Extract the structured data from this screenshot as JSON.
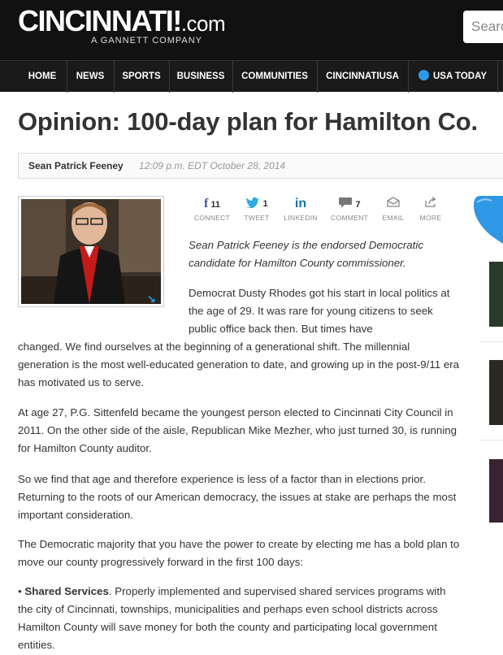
{
  "header": {
    "logo_main": "CINCINNATI",
    "logo_bang": "!",
    "logo_com": ".com",
    "logo_sub": "A GANNETT COMPANY",
    "search_placeholder": "Searc"
  },
  "nav": {
    "items": [
      {
        "label": "HOME"
      },
      {
        "label": "NEWS"
      },
      {
        "label": "SPORTS"
      },
      {
        "label": "BUSINESS"
      },
      {
        "label": "COMMUNITIES"
      },
      {
        "label": "CINCINNATIUSA"
      },
      {
        "label": "USA TODAY"
      }
    ]
  },
  "article": {
    "headline": "Opinion: 100-day plan for Hamilton Co.",
    "author": "Sean Patrick Feeney",
    "timestamp": "12:09 p.m. EDT October 28, 2014",
    "intro": "Sean Patrick Feeney is the endorsed Democratic candidate for Hamilton County commissioner.",
    "p1_part1": "Democrat Dusty Rhodes got his start in local politics at the age of 29. It was rare for young citizens to seek public office back then. But times have",
    "p1_part2": "changed. We find ourselves at the beginning of a generational shift. The millennial generation is the most well-educated generation to date, and growing up in the post-9/11 era has motivated us to serve.",
    "p2": "At age 27, P.G. Sittenfeld became the youngest person elected to Cincinnati City Council in 2011. On the other side of the aisle, Republican Mike Mezher, who just turned 30, is running for Hamilton County auditor.",
    "p3": "So we find that age and therefore experience is less of a factor than in elections prior. Returning to the roots of our American democracy, the issues at stake are perhaps the most important consideration.",
    "p4": "The Democratic majority that you have the power to create by electing me has a bold plan to move our county progressively forward in the first 100 days:",
    "bullet_prefix": "• ",
    "bullet_title": "Shared Services",
    "bullet_text": ". Properly implemented and supervised shared services programs with the city of Cincinnati, townships, municipalities and perhaps even school districts across Hamilton County will save money for both the county and participating local government entities."
  },
  "share": {
    "connect": {
      "count": "11",
      "label": "CONNECT",
      "icon": "facebook-icon"
    },
    "tweet": {
      "count": "1",
      "label": "TWEET",
      "icon": "twitter-icon"
    },
    "linkedin": {
      "label": "LINKEDIN",
      "icon": "linkedin-icon"
    },
    "comment": {
      "count": "7",
      "label": "COMMENT",
      "icon": "comment-icon"
    },
    "email": {
      "label": "EMAIL",
      "icon": "email-icon"
    },
    "more": {
      "label": "MORE",
      "icon": "share-icon"
    }
  },
  "colors": {
    "header_bg": "#111111",
    "accent_blue": "#2f98e6",
    "facebook_blue": "#3b5998",
    "twitter_blue": "#2fa8e6",
    "linkedin_blue": "#0e76a8"
  }
}
